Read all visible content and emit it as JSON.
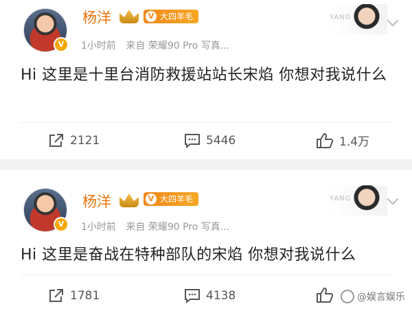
{
  "posts": [
    {
      "username": "杨洋",
      "fan_badge": "大四羊毛",
      "badge_mark": "V",
      "verified_mark": "V",
      "meta": {
        "time": "1小时前",
        "source": "来自 荣耀90 Pro 写真..."
      },
      "watermark": "YANG YANG",
      "content": "Hi 这里是十里台消防救援站站长宋焰 你想对我说什么",
      "actions": {
        "share": "2121",
        "comment": "5446",
        "like": "1.4万"
      }
    },
    {
      "username": "杨洋",
      "fan_badge": "大四羊毛",
      "badge_mark": "V",
      "verified_mark": "V",
      "meta": {
        "time": "1小时前",
        "source": "来自 荣耀90 Pro 写真..."
      },
      "watermark": "YANG YANG",
      "content": "Hi 这里是奋战在特种部队的宋焰 你想对我说什么",
      "actions": {
        "share": "1781",
        "comment": "4138",
        "like": ""
      }
    }
  ],
  "corner_watermark": "@娱言娱乐",
  "colors": {
    "username": "#e8730c",
    "badge": "#f08a1c",
    "meta": "#999999"
  }
}
